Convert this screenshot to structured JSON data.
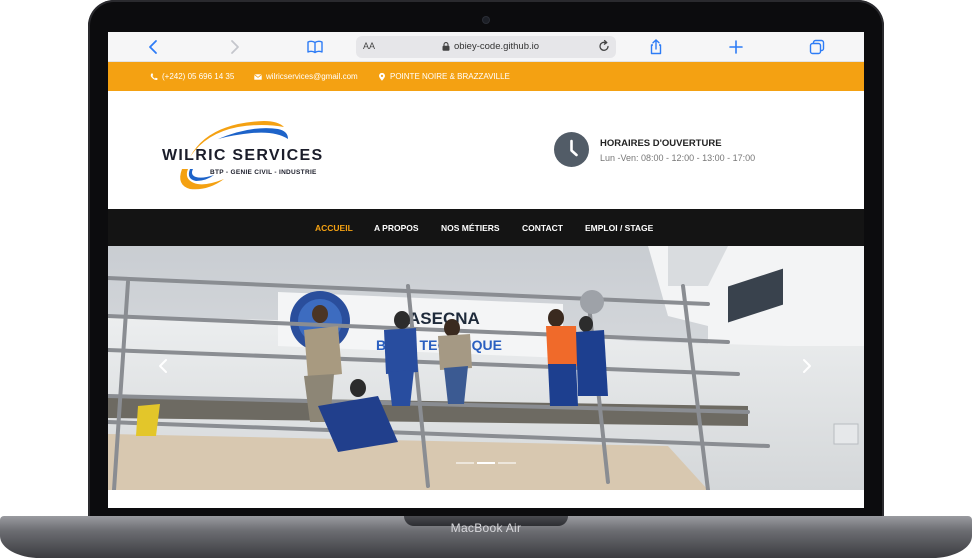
{
  "device": {
    "label": "MacBook Air"
  },
  "browser": {
    "text_size_label": "AA",
    "url": "obiey-code.github.io"
  },
  "topbar": {
    "phone": "(+242) 05 696 14 35",
    "email": "wilricservices@gmail.com",
    "location": "POINTE NOIRE & BRAZZAVILLE"
  },
  "header": {
    "logo_name": "WILRIC SERVICES",
    "logo_tagline": "BTP - GENIE CIVIL - INDUSTRIE",
    "hours_title": "HORAIRES D'OUVERTURE",
    "hours_text": "Lun -Ven: 08:00 - 12:00 - 13:00 - 17:00"
  },
  "nav": {
    "items": [
      "ACCUEIL",
      "A PROPOS",
      "NOS MÉTIERS",
      "CONTACT",
      "EMPLOI / STAGE"
    ],
    "active_index": 0
  },
  "hero": {
    "sign_text": "ASECNA",
    "sign_text_2": "BLOC TECHNIQUE",
    "slide_count": 3,
    "active_slide": 1
  },
  "colors": {
    "accent": "#f4a112",
    "nav_bg": "#141414",
    "browser_blue": "#2d7cf6"
  }
}
